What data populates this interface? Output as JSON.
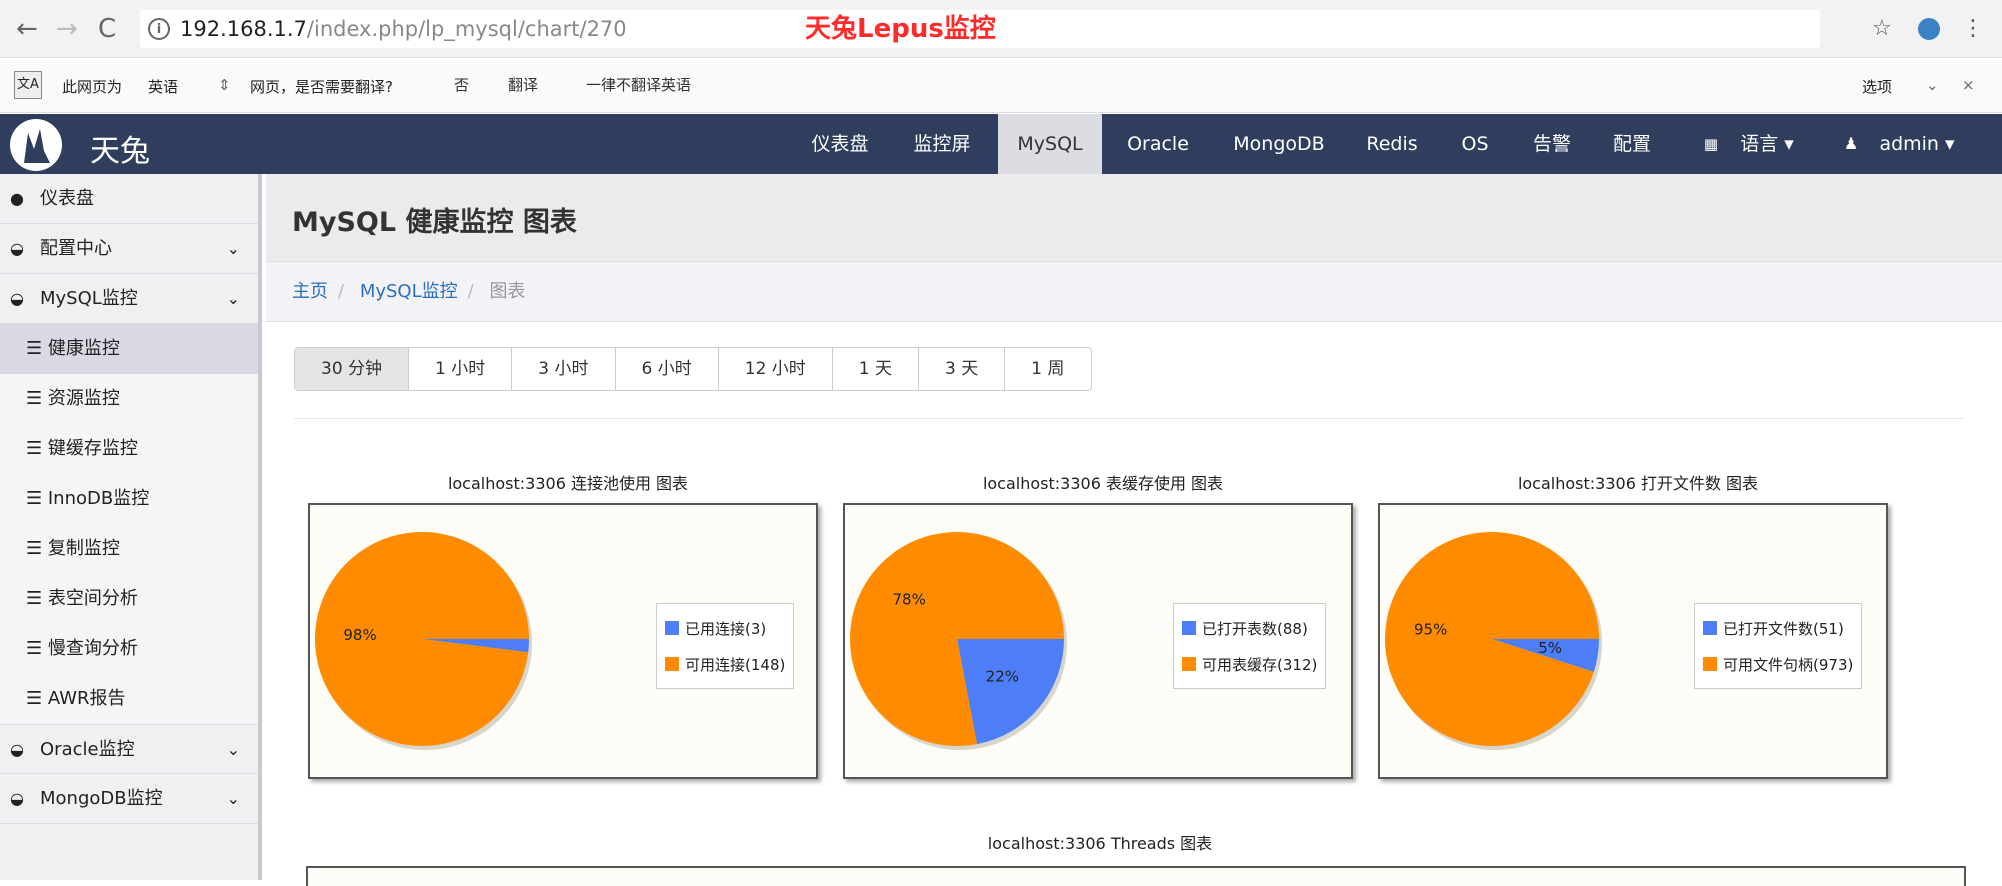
{
  "browser": {
    "back": "←",
    "forward": "→",
    "reload": "C",
    "url_host": "192.168.1.7",
    "url_path": "/index.php/lp_mysql/chart/270",
    "overlay_title": "天兔Lepus监控",
    "star": "☆",
    "menu": "⋮"
  },
  "translate_bar": {
    "prefix": "此网页为",
    "language": "英语",
    "question": "网页，是否需要翻译?",
    "no": "否",
    "translate": "翻译",
    "never": "一律不翻译英语",
    "options": "选项",
    "close": "×"
  },
  "topnav": {
    "brand": "天兔",
    "items": [
      {
        "label": "仪表盘"
      },
      {
        "label": "监控屏"
      },
      {
        "label": "MySQL"
      },
      {
        "label": "Oracle"
      },
      {
        "label": "MongoDB"
      },
      {
        "label": "Redis"
      },
      {
        "label": "OS"
      },
      {
        "label": "告警"
      },
      {
        "label": "配置"
      },
      {
        "label": "语言 ▾"
      },
      {
        "label": "admin ▾"
      }
    ]
  },
  "sidebar": {
    "dashboard": "仪表盘",
    "config": "配置中心",
    "mysql": "MySQL监控",
    "sub": [
      {
        "label": "健康监控"
      },
      {
        "label": "资源监控"
      },
      {
        "label": "键缓存监控"
      },
      {
        "label": "InnoDB监控"
      },
      {
        "label": "复制监控"
      },
      {
        "label": "表空间分析"
      },
      {
        "label": "慢查询分析"
      },
      {
        "label": "AWR报告"
      }
    ],
    "oracle": "Oracle监控",
    "mongodb": "MongoDB监控"
  },
  "page": {
    "title": "MySQL 健康监控 图表",
    "breadcrumb": {
      "home": "主页",
      "section": "MySQL监控",
      "current": "图表"
    },
    "ranges": [
      "30 分钟",
      "1 小时",
      "3 小时",
      "6 小时",
      "12 小时",
      "1 天",
      "3 天",
      "1 周"
    ],
    "threads_title": "localhost:3306 Threads 图表"
  },
  "colors": {
    "used": "#4d7ef7",
    "available": "#ff8c00"
  },
  "chart_data": [
    {
      "type": "pie",
      "title": "localhost:3306 连接池使用 图表",
      "slices": [
        {
          "label": "已用连接(3)",
          "value": 3,
          "pct_label": ""
        },
        {
          "label": "可用连接(148)",
          "value": 148,
          "pct_label": "98%"
        }
      ]
    },
    {
      "type": "pie",
      "title": "localhost:3306 表缓存使用 图表",
      "slices": [
        {
          "label": "已打开表数(88)",
          "value": 88,
          "pct_label": "22%"
        },
        {
          "label": "可用表缓存(312)",
          "value": 312,
          "pct_label": "78%"
        }
      ]
    },
    {
      "type": "pie",
      "title": "localhost:3306 打开文件数 图表",
      "slices": [
        {
          "label": "已打开文件数(51)",
          "value": 51,
          "pct_label": "5%"
        },
        {
          "label": "可用文件句柄(973)",
          "value": 973,
          "pct_label": "95%"
        }
      ]
    }
  ]
}
